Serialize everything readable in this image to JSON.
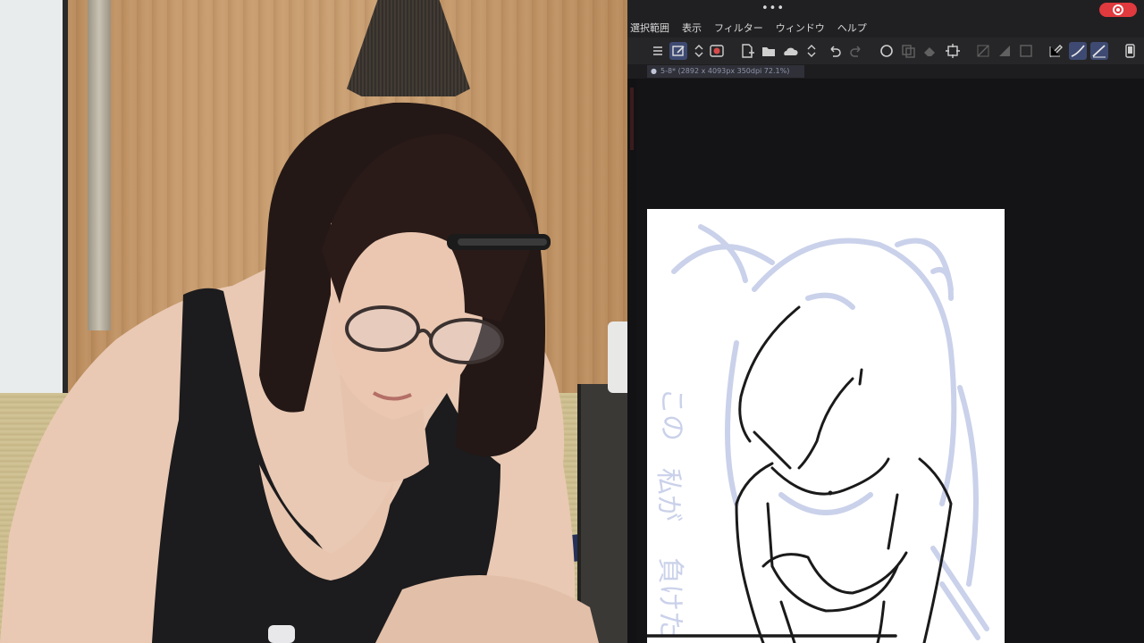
{
  "app": {
    "title_dots": "•••",
    "menu": [
      "選択範囲",
      "表示",
      "フィルター",
      "ウィンドウ",
      "ヘルプ"
    ],
    "document_tab": {
      "dot": "●",
      "label": "5-8* (2892 x 4093px 350dpi 72.1%)"
    },
    "toolbar_icons": [
      "menu-icon",
      "canvas-tool-icon",
      "updown-arrows-icon",
      "brush-preview-icon",
      "new-file-icon",
      "open-folder-icon",
      "cloud-save-icon",
      "updown-arrows-icon",
      "undo-icon",
      "redo-icon",
      "circle-select-icon",
      "copy-icon",
      "eraser-fill-icon",
      "transform-icon",
      "snap-a-icon",
      "snap-b-icon",
      "snap-c-icon",
      "pen-tool-icon",
      "curve-pen-icon",
      "line-pen-icon",
      "device-icon"
    ],
    "colors": {
      "accent_active": "#3e4a72",
      "close_button": "#e0393e",
      "sketch_blue": "#c5cde8",
      "ink": "#1a1a1a"
    }
  },
  "canvas": {
    "handwritten_text": [
      "この",
      "私が",
      "負けた"
    ]
  }
}
